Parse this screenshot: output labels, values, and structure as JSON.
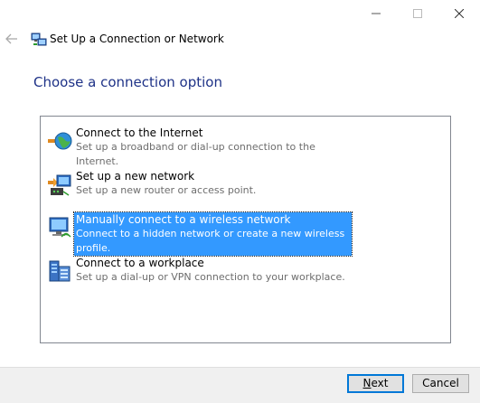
{
  "window": {
    "title": "Set Up a Connection or Network",
    "controls": [
      "minimize-icon",
      "maximize-icon",
      "close-icon"
    ]
  },
  "page": {
    "heading": "Choose a connection option"
  },
  "options": [
    {
      "icon": "globe-network-icon",
      "title": "Connect to the Internet",
      "description": "Set up a broadband or dial-up connection to the Internet.",
      "selected": false
    },
    {
      "icon": "router-network-icon",
      "title": "Set up a new network",
      "description": "Set up a new router or access point.",
      "selected": false
    },
    {
      "icon": "wireless-network-icon",
      "title": "Manually connect to a wireless network",
      "description": "Connect to a hidden network or create a new wireless profile.",
      "selected": true
    },
    {
      "icon": "workplace-icon",
      "title": "Connect to a workplace",
      "description": "Set up a dial-up or VPN connection to your workplace.",
      "selected": false
    }
  ],
  "buttons": {
    "next_mnemonic": "N",
    "next_rest": "ext",
    "cancel": "Cancel"
  },
  "colors": {
    "heading": "#1e3287",
    "selection": "#3399ff",
    "footer": "#f0f0f0",
    "focus_border": "#0078d7"
  }
}
